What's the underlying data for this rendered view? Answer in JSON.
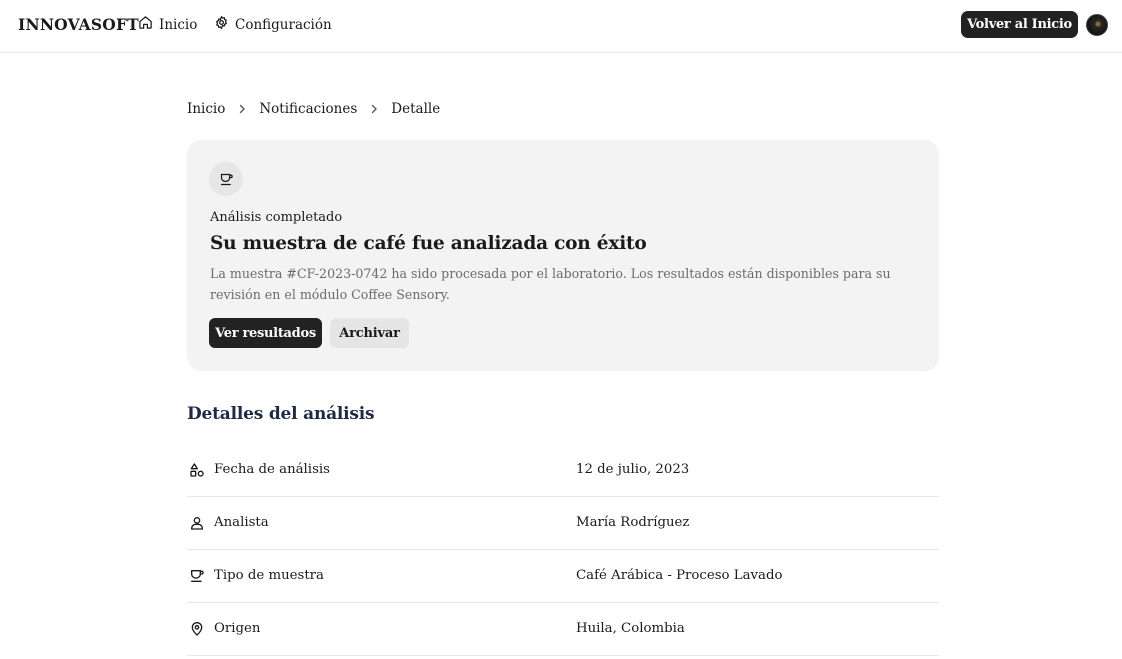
{
  "header": {
    "brand": "INNOVASOFT",
    "nav": [
      {
        "label": "Inicio",
        "icon": "home-icon"
      },
      {
        "label": "Configuración",
        "icon": "gear-icon"
      }
    ],
    "back_button": "Volver al Inicio"
  },
  "breadcrumb": {
    "items": [
      "Inicio",
      "Notificaciones",
      "Detalle"
    ]
  },
  "notification": {
    "icon": "coffee-cup-icon",
    "kicker": "Análisis completado",
    "title": "Su muestra de café fue analizada con éxito",
    "description": "La muestra #CF-2023-0742 ha sido procesada por el laboratorio. Los resultados están disponibles para su revisión en el módulo Coffee Sensory.",
    "primary_button": "Ver resultados",
    "secondary_button": "Archivar"
  },
  "details": {
    "title": "Detalles del análisis",
    "rows": [
      {
        "icon": "shapes-icon",
        "label": "Fecha de análisis",
        "value": "12 de julio, 2023"
      },
      {
        "icon": "user-icon",
        "label": "Analista",
        "value": "María Rodríguez"
      },
      {
        "icon": "coffee-cup-icon",
        "label": "Tipo de muestra",
        "value": "Café Arábica - Proceso Lavado"
      },
      {
        "icon": "map-pin-icon",
        "label": "Origen",
        "value": "Huila, Colombia"
      }
    ]
  }
}
